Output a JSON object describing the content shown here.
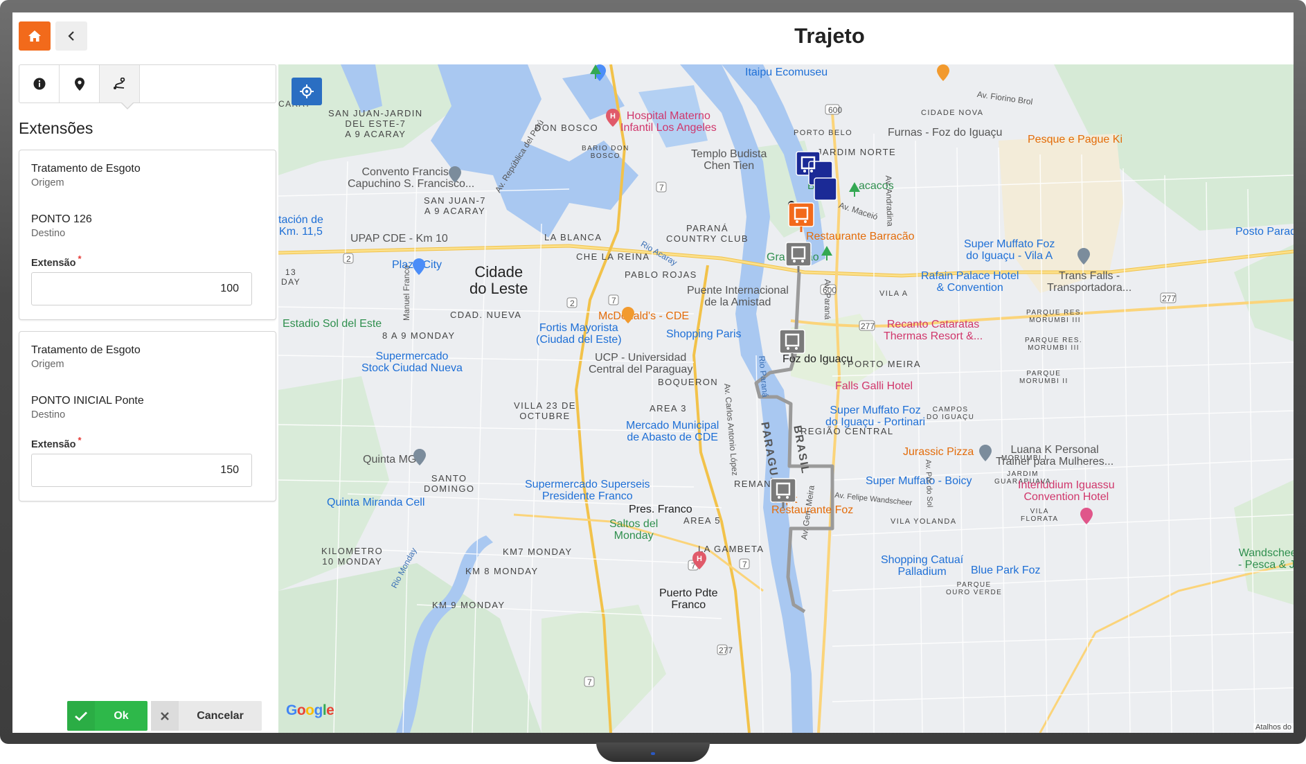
{
  "header": {
    "title": "Trajeto"
  },
  "panel": {
    "section_title": "Extensões",
    "tabs": [
      {
        "icon": "info-icon"
      },
      {
        "icon": "map-pin-icon"
      },
      {
        "icon": "route-icon"
      }
    ],
    "cards": [
      {
        "origin_name": "Tratamento de Esgoto",
        "origin_label": "Origem",
        "dest_name": "PONTO 126",
        "dest_label": "Destino",
        "field_label": "Extensão",
        "value": "100"
      },
      {
        "origin_name": "Tratamento de Esgoto",
        "origin_label": "Origem",
        "dest_name": "PONTO INICIAL Ponte",
        "dest_label": "Destino",
        "field_label": "Extensão",
        "value": "150"
      }
    ]
  },
  "footer": {
    "ok_label": "Ok",
    "cancel_label": "Cancelar"
  },
  "map": {
    "attribution": "Atalhos do",
    "google": [
      "G",
      "o",
      "o",
      "g",
      "l",
      "e"
    ],
    "cities": {
      "cde_1": "Cidade",
      "cde_2": "do Leste",
      "foz": "Foz do Iguaçu",
      "pres_franco": "Pres. Franco",
      "puerto_1": "Puerto Pdte",
      "puerto_2": "Franco"
    },
    "districts": {
      "san_juan_jardin_1": "SAN JUAN-JARDIN",
      "san_juan_jardin_2": "DEL ESTE-7",
      "san_juan_jardin_3": "A 9 ACARAY",
      "don_bosco": "DON BOSCO",
      "bario_don_bosco_1": "BARIO DON",
      "bario_don_bosco_2": "BOSCO",
      "san_juan7_1": "SAN JUAN-7",
      "san_juan7_2": "A 9 ACARAY",
      "la_blanca": "LA BLANCA",
      "che_la_reina": "CHE LA REINA",
      "pablo_rojas": "PABLO ROJAS",
      "parana_cc_1": "PARANÁ",
      "parana_cc_2": "COUNTRY CLUB",
      "cdad_nueva": "CDAD. NUEVA",
      "monday_8a9": "8 A 9 MONDAY",
      "boqueron": "BOQUERON",
      "villa23_1": "VILLA 23 DE",
      "villa23_2": "OCTUBRE",
      "area3": "AREA 3",
      "santo_domingo_1": "SANTO",
      "santo_domingo_2": "DOMINGO",
      "remansito": "REMANSITO",
      "area5": "AREA 5",
      "la_gambeta": "LA GAMBETA",
      "km10_1": "KILOMETRO",
      "km10_2": "10 MONDAY",
      "km7": "KM7 MONDAY",
      "km8": "KM 8 MONDAY",
      "km9": "KM 9 MONDAY",
      "porto_belo": "PORTO BELO",
      "cidade_nova": "CIDADE NOVA",
      "jardim_norte": "JARDIM NORTE",
      "porto_meira": "PORTO MEIRA",
      "regiao_central": "REGIÃO CENTRAL",
      "vila_a": "VILA A",
      "parque_res_1": "PARQUE RES.",
      "parque_res_2": "MORUMBI III",
      "parque_res2_1": "PARQUE RES.",
      "parque_res2_2": "MORUMBI III",
      "parque_morumbi_1": "PARQUE",
      "parque_morumbi_2": "MORUMBI II",
      "campos_1": "CAMPOS",
      "campos_2": "DO IGUAÇU",
      "morumbi_i": "MORUMBI I",
      "jardim_guarapuava_1": "JARDIM",
      "jardim_guarapuava_2": "GUARAPUAVA",
      "vila_florata_1": "VILA",
      "vila_florata_2": "FLORATA",
      "vila_yolanda": "VILA YOLANDA",
      "parque_ouro_1": "PARQUE",
      "parque_ouro_2": "OURO VERDE",
      "edge_aray": "CARAY",
      "edge_day_1": "13",
      "edge_day_2": "DAY"
    },
    "pois": {
      "itaipu": "Itaipu Ecomuseu",
      "hospital_1": "Hospital Materno",
      "hospital_2": "Infantil Los Angeles",
      "templo_1": "Templo Budista",
      "templo_2": "Chen Tien",
      "furnas": "Furnas - Foz do Iguaçu",
      "pesque": "Pesque e Pague Ki",
      "convento_1": "Convento Francisco",
      "convento_2": "Capuchino S. Francisco...",
      "bosque": "Bosq",
      "macacos": "acacos",
      "estacion_1": "tación de",
      "estacion_2": "Km. 11,5",
      "upap": "UPAP CDE - Km 10",
      "plaza_city": "Plaza City",
      "restaurante_barracao": "Restaurante Barracão",
      "super_muffato_a_1": "Super Muffato Foz",
      "super_muffato_a_2": "do Iguaçu - Vila A",
      "posto_parada": "Posto Paradã",
      "gramadao": "Gramadão",
      "rafain_1": "Rafain Palace Hotel",
      "rafain_2": "& Convention",
      "trans_falls_1": "Trans Falls -",
      "trans_falls_2": "Transportadora...",
      "puente_1": "Puente Internacional",
      "puente_2": "de la Amistad",
      "mcdonalds": "McDonald's - CDE",
      "fortis_1": "Fortis Mayorista",
      "fortis_2": "(Ciudad del Este)",
      "shopping_paris": "Shopping Paris",
      "recanto_1": "Recanto Cataratas",
      "recanto_2": "Thermas Resort &...",
      "estadio": "Estadio Sol del Este",
      "supermercado_stock_1": "Supermercado",
      "supermercado_stock_2": "Stock Ciudad Nueva",
      "ucp_1": "UCP - Universidad",
      "ucp_2": "Central del Paraguay",
      "falls_galli": "Falls Galli Hotel",
      "super_muffato_p_1": "Super Muffato Foz",
      "super_muffato_p_2": "do Iguaçu - Portinari",
      "mercado_1": "Mercado Municipal",
      "mercado_2": "de Abasto de CDE",
      "jurassic": "Jurassic Pizza",
      "luana_1": "Luana K Personal",
      "luana_2": "Trainer para Mulheres...",
      "quinta_mg": "Quinta MG",
      "supersel_1": "Supermercado Superseis",
      "supersel_2": "Presidente Franco",
      "capit": "Capit",
      "restaurante_foz": "Restaurante Foz",
      "super_muffato_b": "Super Muffato - Boicy",
      "interludium_1": "Interludium Iguassu",
      "interludium_2": "Convention Hotel",
      "quinta_miranda": "Quinta Miranda Cell",
      "saltos_1": "Saltos del",
      "saltos_2": "Monday",
      "shopping_cataui_1": "Shopping Catuaí",
      "shopping_cataui_2": "Palladium",
      "blue_park": "Blue Park Foz",
      "wandscheer_1": "Wandscheer",
      "wandscheer_2": "- Pesca & Ja"
    },
    "roads": {
      "republica": "Av. República del Perú",
      "manuel_franco": "Manuel Franco",
      "rio_acaray": "Rio Acaray",
      "carlos_lopez": "Av. Carlos Antonio López",
      "rio_parana": "Rio Paraná",
      "paraguay": "PARAGUAY",
      "brasil": "BRASIL",
      "av_parana": "Av. Paraná",
      "gen_meira": "Av. Gen. Meira",
      "macaio": "Av. Maceió",
      "andradina": "Av. Andradina",
      "fiorino": "Av. Fiorino Brol",
      "wandscheer": "Av. Felipe Wandscheer",
      "pardo": "Av. Pôr do Sol",
      "rio_monday": "Rio Monday",
      "r600": "600",
      "r7a": "7",
      "r7b": "7",
      "r7c": "7",
      "r7d": "7",
      "r7e": "7",
      "r2a": "2",
      "r2b": "2",
      "r277a": "277",
      "r277b": "277",
      "r277c": "277",
      "r600b": "600"
    }
  },
  "colors": {
    "accent_orange": "#f26a1b",
    "ok_green": "#2eb84a",
    "locate_blue": "#2a6ec2",
    "marker_blue": "#1b2a96",
    "marker_gray": "#7a7a7a",
    "route_gray": "#9a9a9a"
  }
}
